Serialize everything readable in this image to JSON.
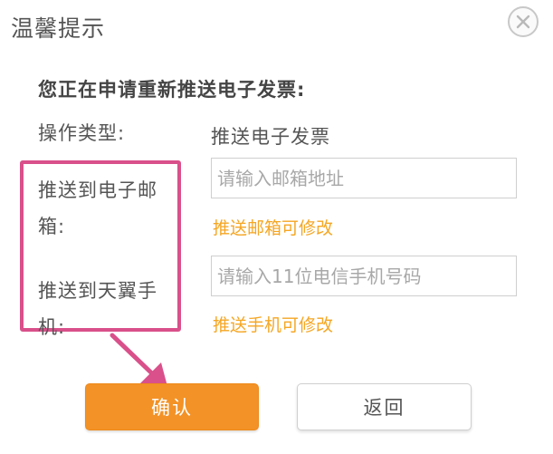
{
  "dialog": {
    "title": "温馨提示",
    "heading": "您正在申请重新推送电子发票:"
  },
  "operation": {
    "label": "操作类型:",
    "value": "推送电子发票"
  },
  "email": {
    "label_line1": "推送到电子邮",
    "label_line2": "箱:",
    "placeholder": "请输入邮箱地址",
    "value": "",
    "hint": "推送邮箱可修改"
  },
  "phone": {
    "label_line1": "推送到天翼手",
    "label_line2": "机:",
    "placeholder": "请输入11位电信手机号码",
    "value": "",
    "hint": "推送手机可修改"
  },
  "buttons": {
    "confirm": "确认",
    "back": "返回"
  },
  "icons": {
    "close": "close-icon",
    "arrow": "arrow-icon"
  },
  "colors": {
    "accent": "#f39226",
    "hint": "#f5a623",
    "highlight": "#d9508a"
  }
}
